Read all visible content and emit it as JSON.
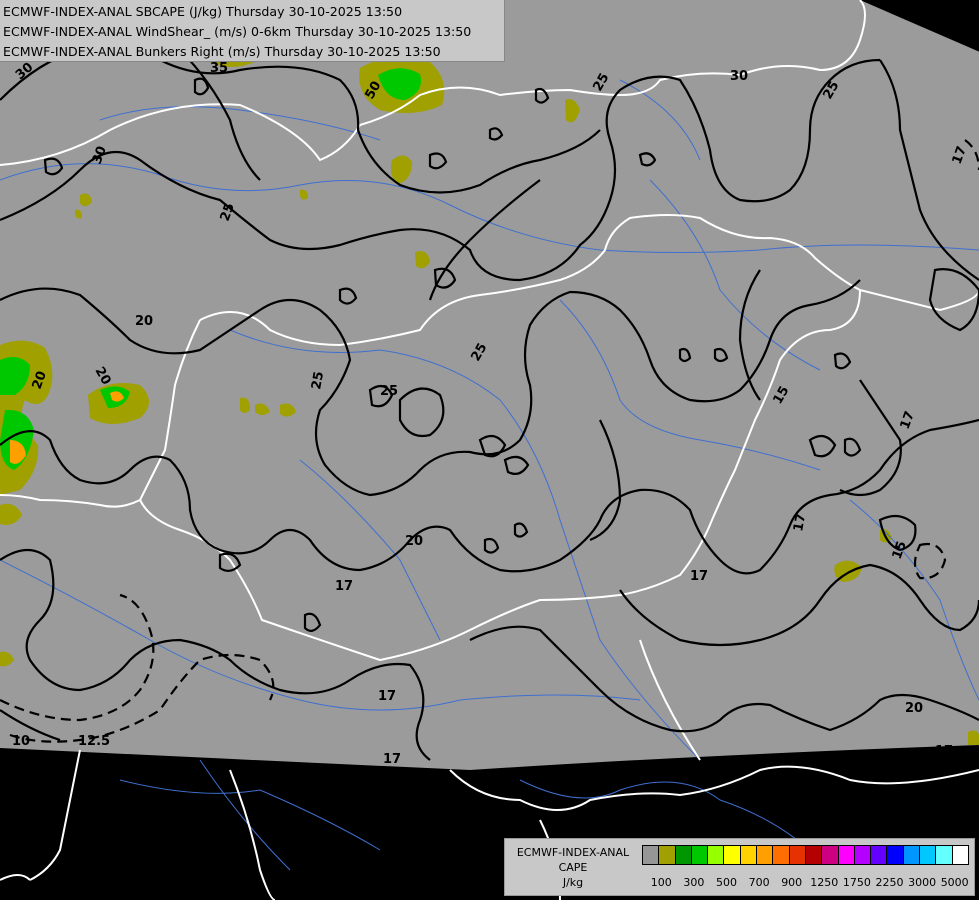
{
  "header": {
    "lines": [
      "ECMWF-INDEX-ANAL SBCAPE (J/kg) Thursday 30-10-2025 13:50",
      "ECMWF-INDEX-ANAL WindShear_ (m/s) 0-6km Thursday 30-10-2025 13:50",
      "ECMWF-INDEX-ANAL Bunkers Right (m/s) Thursday 30-10-2025 13:50"
    ]
  },
  "legend": {
    "title_lines": [
      "ECMWF-INDEX-ANAL",
      "CAPE",
      "J/kg"
    ],
    "colors": [
      "#969696",
      "#a0a000",
      "#009600",
      "#00c800",
      "#96ff00",
      "#ffff00",
      "#ffd200",
      "#ffa000",
      "#ff6e00",
      "#e63200",
      "#b40000",
      "#cc0080",
      "#ff00ff",
      "#b400ff",
      "#6400ff",
      "#0000ff",
      "#0096ff",
      "#00c8ff",
      "#64ffff",
      "#ffffff"
    ],
    "tick_labels": [
      "100",
      "300",
      "500",
      "700",
      "900",
      "1250",
      "1750",
      "2250",
      "3000",
      "5000"
    ]
  },
  "contour_labels": [
    "30",
    "35",
    "30",
    "25",
    "30",
    "25",
    "20",
    "20",
    "25",
    "25",
    "20",
    "17",
    "17",
    "15",
    "17",
    "15",
    "17",
    "20",
    "17",
    "17",
    "17",
    "10",
    "12.5",
    "20",
    "17",
    "50",
    "25",
    "25"
  ],
  "colors": {
    "land_domain": "#9b9b9b",
    "outside": "#000000",
    "rivers": "#3f6fd0",
    "borders": "#ffffff",
    "contours": "#000000"
  }
}
